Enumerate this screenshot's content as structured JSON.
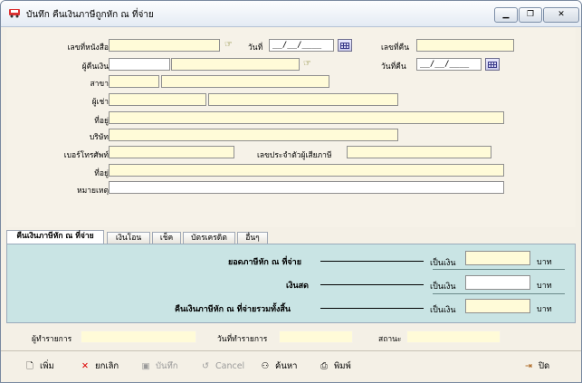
{
  "window": {
    "title": "บันทึก คืนเงินภาษีถูกหัก ณ ที่จ่าย",
    "controls": [
      "▁",
      "❐",
      "✕"
    ]
  },
  "form": {
    "doc_no_label": "เลขที่หนังสือ",
    "doc_no": "",
    "date_label": "วันที่",
    "date_value": "__/__/____",
    "refund_no_label": "เลขที่คืน",
    "refund_no": "",
    "payer_label": "ผู้คืนเงิน",
    "refund_date_label": "วันที่คืน",
    "refund_date_value": "__/__/____",
    "branch_label": "สาขา",
    "lessee_label": "ผู้เช่า",
    "address_label": "ที่อยู่",
    "company_label": "บริษัท",
    "phone_label": "เบอร์โทรศัพท์",
    "taxid_label": "เลขประจำตัวผู้เสียภาษี",
    "address2_label": "ที่อยู่",
    "note_label": "หมายเหตุ"
  },
  "tabs": [
    {
      "label": "คืนเงินภาษีหัก ณ ที่จ่าย"
    },
    {
      "label": "เงินโอน"
    },
    {
      "label": "เช็ค"
    },
    {
      "label": "บัตรเครดิต"
    },
    {
      "label": "อื่นๆ"
    }
  ],
  "summary": {
    "row1_label": "ยอดภาษีหัก ณ ที่จ่าย",
    "row2_label": "เงินสด",
    "row3_label": "คืนเงินภาษีหัก ณ ที่จ่ายรวมทั้งสิ้น",
    "currency_label": "เป็นเงิน",
    "unit": "บาท"
  },
  "footer": {
    "creator_label": "ผู้ทำรายการ",
    "created_date_label": "วันที่ทำรายการ",
    "status_label": "สถานะ"
  },
  "toolbar": {
    "add": "เพิ่ม",
    "cancel_doc": "ยกเลิก",
    "save": "บันทึก",
    "undo": "Cancel",
    "search": "ค้นหา",
    "print": "พิมพ์",
    "close": "ปิด"
  },
  "colors": {
    "required_field": "#fffbd8",
    "tab_panel": "#c9e4e4",
    "window_bg": "#f4f0e6"
  }
}
